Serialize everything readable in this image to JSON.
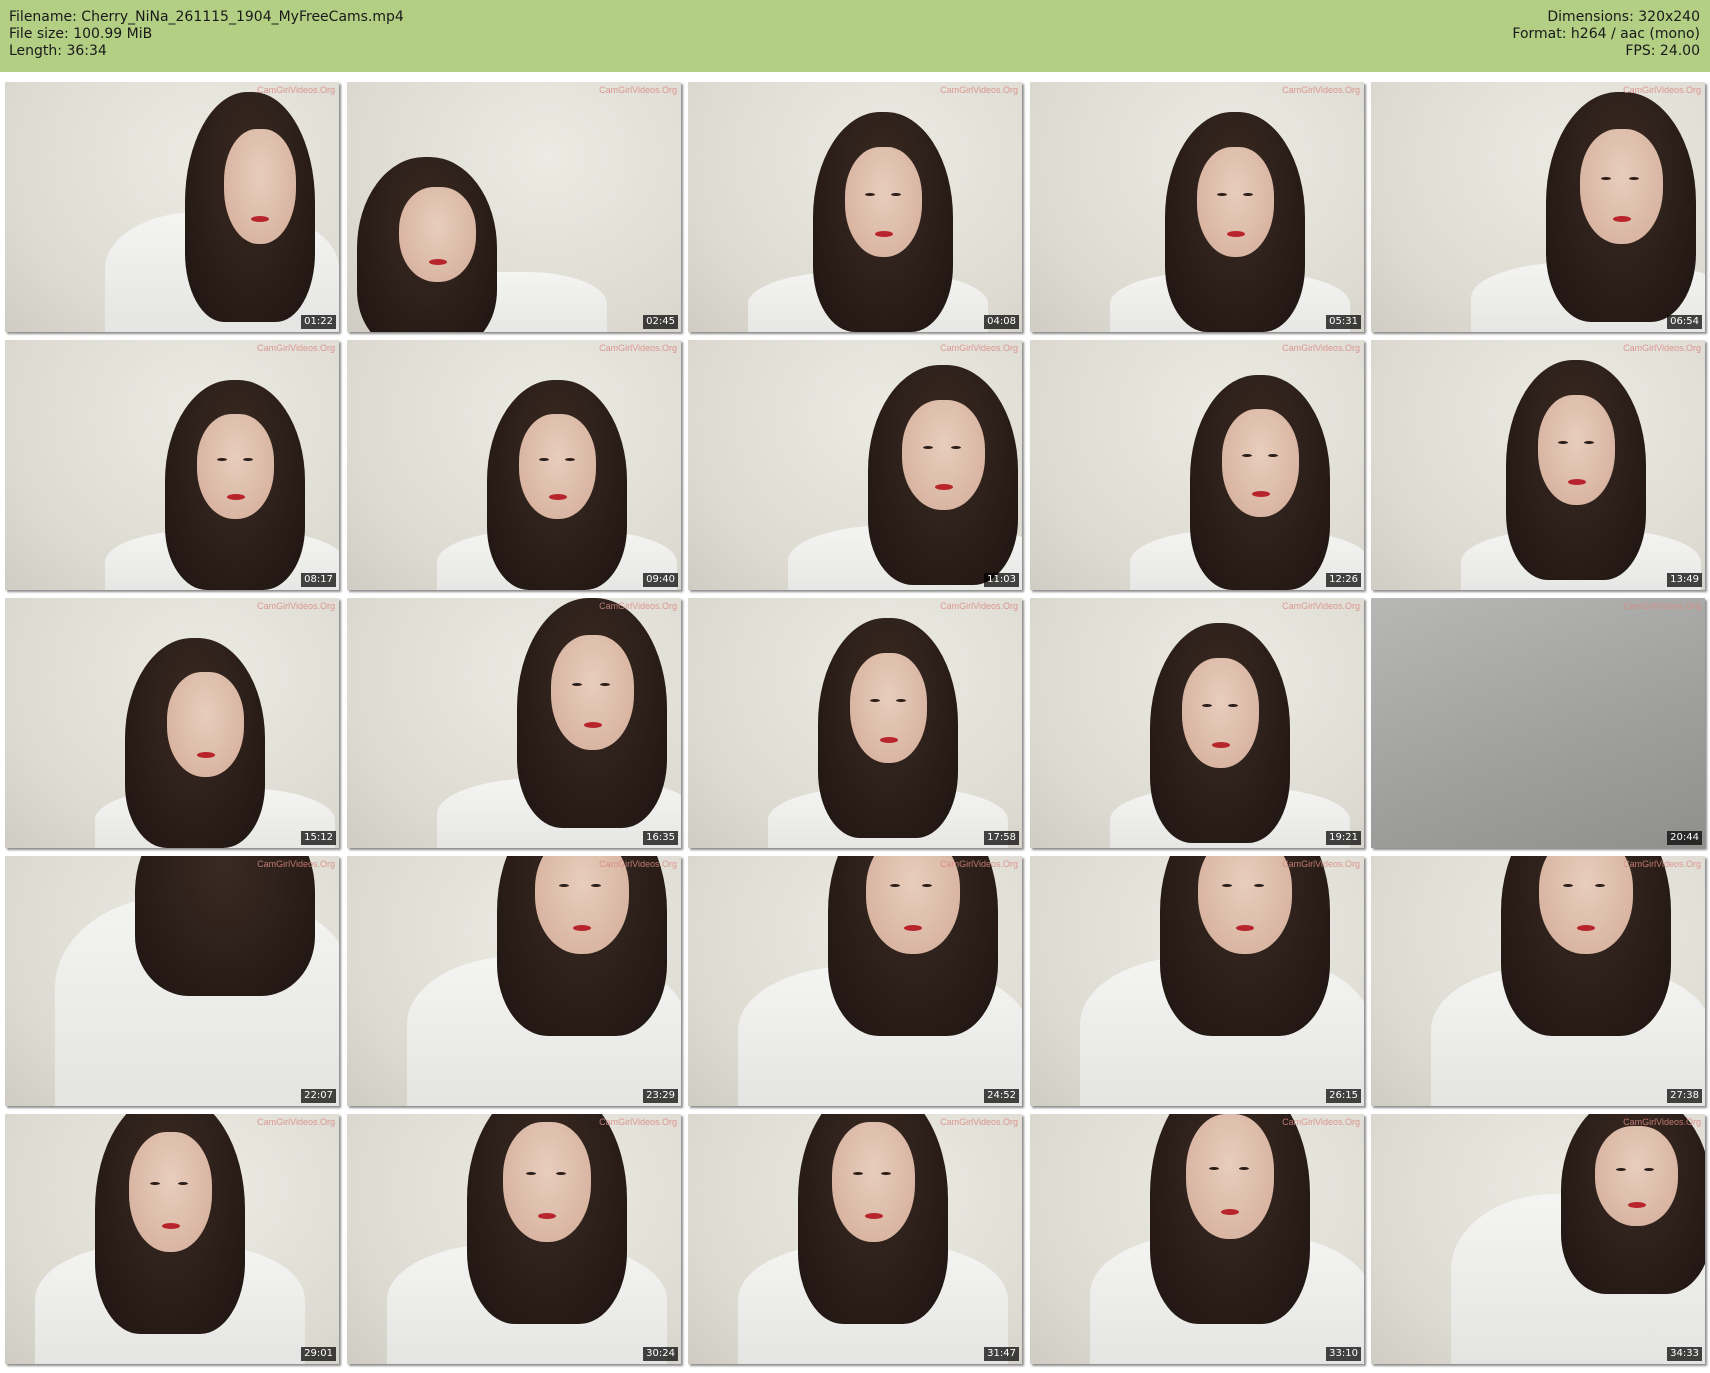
{
  "header": {
    "filename_label": "Filename: Cherry_NiNa_261115_1904_MyFreeCams.mp4",
    "filesize_label": "File size: 100.99 MiB",
    "length_label": "Length: 36:34",
    "dimensions_label": "Dimensions: 320x240",
    "format_label": "Format: h264 / aac (mono)",
    "fps_label": "FPS: 24.00",
    "background_color": "#b2cf84"
  },
  "watermark": "CamGirlVideos.Org",
  "thumbnails": [
    {
      "timestamp": "01:22"
    },
    {
      "timestamp": "02:45"
    },
    {
      "timestamp": "04:08"
    },
    {
      "timestamp": "05:31"
    },
    {
      "timestamp": "06:54"
    },
    {
      "timestamp": "08:17"
    },
    {
      "timestamp": "09:40"
    },
    {
      "timestamp": "11:03"
    },
    {
      "timestamp": "12:26"
    },
    {
      "timestamp": "13:49"
    },
    {
      "timestamp": "15:12"
    },
    {
      "timestamp": "16:35"
    },
    {
      "timestamp": "17:58"
    },
    {
      "timestamp": "19:21"
    },
    {
      "timestamp": "20:44"
    },
    {
      "timestamp": "22:07"
    },
    {
      "timestamp": "23:29"
    },
    {
      "timestamp": "24:52"
    },
    {
      "timestamp": "26:15"
    },
    {
      "timestamp": "27:38"
    },
    {
      "timestamp": "29:01"
    },
    {
      "timestamp": "30:24"
    },
    {
      "timestamp": "31:47"
    },
    {
      "timestamp": "33:10"
    },
    {
      "timestamp": "34:33"
    }
  ]
}
